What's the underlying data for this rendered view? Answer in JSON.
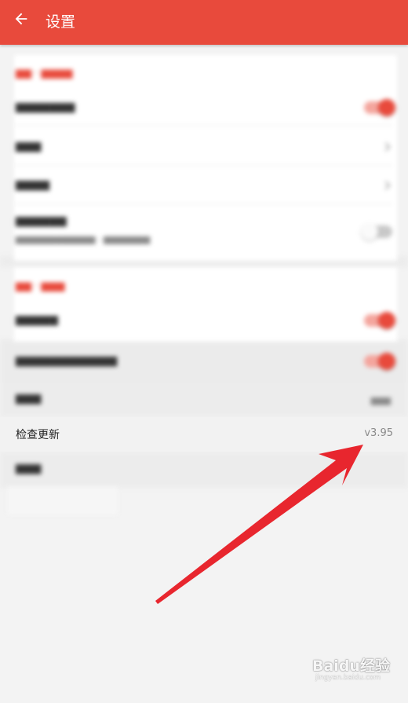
{
  "app_bar": {
    "title": "设置",
    "back_icon": "arrow-left-icon",
    "background_color": "#e84a3c"
  },
  "check_update": {
    "label": "检查更新",
    "version": "v3.95"
  },
  "annotation": {
    "arrow_color": "#e8262e"
  },
  "watermark": {
    "brand": "Baidu经验",
    "url": "jingyan.baidu.com"
  }
}
